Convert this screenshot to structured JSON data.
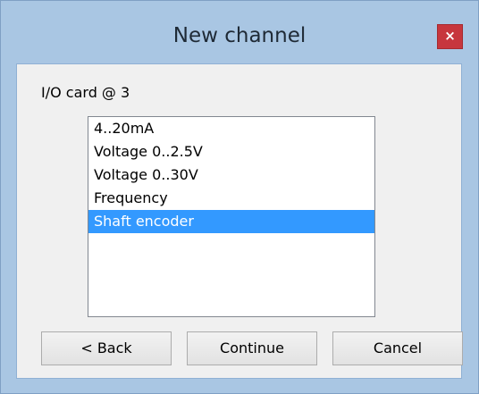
{
  "window": {
    "title": "New channel",
    "close_label": "×"
  },
  "card_label": "I/O card @ 3",
  "list": {
    "items": [
      {
        "label": "4..20mA",
        "selected": false
      },
      {
        "label": "Voltage 0..2.5V",
        "selected": false
      },
      {
        "label": "Voltage 0..30V",
        "selected": false
      },
      {
        "label": "Frequency",
        "selected": false
      },
      {
        "label": "Shaft encoder",
        "selected": true
      }
    ],
    "selected_value": "Shaft encoder"
  },
  "buttons": {
    "back": "< Back",
    "continue": "Continue",
    "cancel": "Cancel"
  },
  "colors": {
    "frame": "#a9c6e3",
    "close_button": "#c7363d",
    "selection": "#3399ff"
  }
}
